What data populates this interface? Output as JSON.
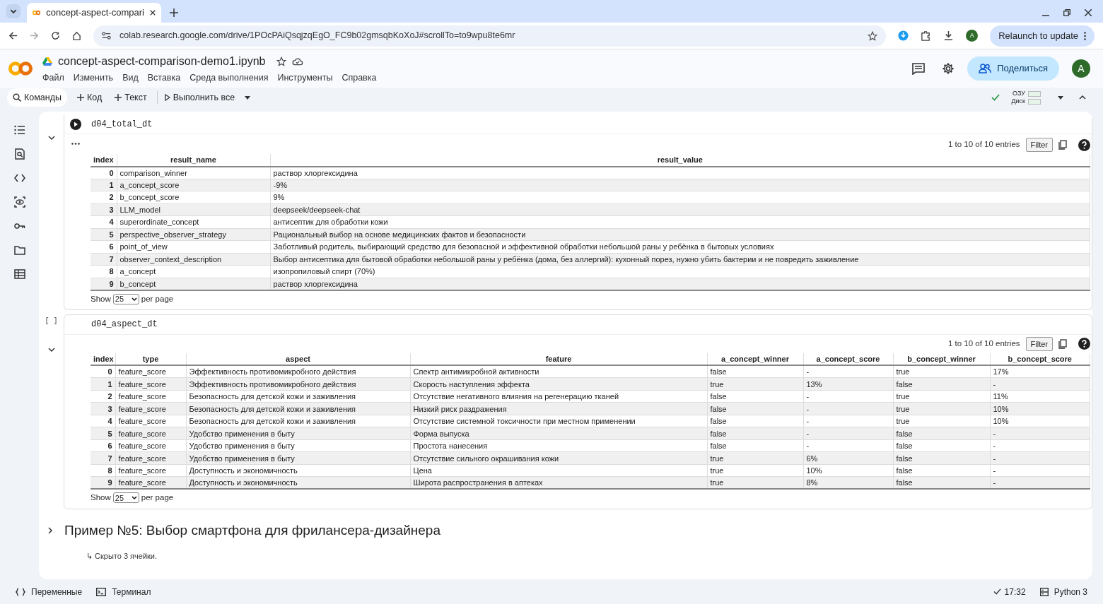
{
  "browser": {
    "tab_title": "concept-aspect-compari",
    "url": "colab.research.google.com/drive/1POcPAiQsqjzqEgO_FC9b02gmsqbKoXoJ#scrollTo=to9wpu8te6mr",
    "profile_letter": "A",
    "relaunch_button": "Relaunch to update"
  },
  "header": {
    "title": "concept-aspect-comparison-demo1.ipynb",
    "menu": [
      "Файл",
      "Изменить",
      "Вид",
      "Вставка",
      "Среда выполнения",
      "Инструменты",
      "Справка"
    ],
    "share_button": "Поделиться",
    "avatar_letter": "A"
  },
  "toolbar": {
    "commands": "Команды",
    "add_code": "Код",
    "add_text": "Текст",
    "run_all": "Выполнить все",
    "ram_label": "ОЗУ",
    "disk_label": "Диск"
  },
  "cells": [
    {
      "code": "d04_total_dt",
      "output": {
        "entries_info": "1 to 10 of 10 entries",
        "filter_button": "Filter",
        "show_label": "Show",
        "page_size": "25",
        "per_page_label": "per page",
        "columns": [
          "index",
          "result_name",
          "result_value"
        ],
        "rows": [
          [
            "0",
            "comparison_winner",
            "раствор хлоргексидина"
          ],
          [
            "1",
            "a_concept_score",
            "-9%"
          ],
          [
            "2",
            "b_concept_score",
            "9%"
          ],
          [
            "3",
            "LLM_model",
            "deepseek/deepseek-chat"
          ],
          [
            "4",
            "superordinate_concept",
            "антисептик для обработки кожи"
          ],
          [
            "5",
            "perspective_observer_strategy",
            "Рациональный выбор на основе медицинских фактов и безопасности"
          ],
          [
            "6",
            "point_of_view",
            "Заботливый родитель, выбирающий средство для безопасной и эффективной обработки небольшой раны у ребёнка в бытовых условиях"
          ],
          [
            "7",
            "observer_context_description",
            "Выбор антисептика для бытовой обработки небольшой раны у ребёнка (дома, без аллергий): кухонный порез, нужно убить бактерии и не повредить заживление"
          ],
          [
            "8",
            "a_concept",
            "изопропиловый спирт (70%)"
          ],
          [
            "9",
            "b_concept",
            "раствор хлоргексидина"
          ]
        ]
      }
    },
    {
      "prompt": "[ ]",
      "code": "d04_aspect_dt",
      "output": {
        "entries_info": "1 to 10 of 10 entries",
        "filter_button": "Filter",
        "show_label": "Show",
        "page_size": "25",
        "per_page_label": "per page",
        "columns": [
          "index",
          "type",
          "aspect",
          "feature",
          "a_concept_winner",
          "a_concept_score",
          "b_concept_winner",
          "b_concept_score"
        ],
        "rows": [
          [
            "0",
            "feature_score",
            "Эффективность противомикробного действия",
            "Спектр антимикробной активности",
            "false",
            "-",
            "true",
            "17%"
          ],
          [
            "1",
            "feature_score",
            "Эффективность противомикробного действия",
            "Скорость наступления эффекта",
            "true",
            "13%",
            "false",
            "-"
          ],
          [
            "2",
            "feature_score",
            "Безопасность для детской кожи и заживления",
            "Отсутствие негативного влияния на регенерацию тканей",
            "false",
            "-",
            "true",
            "11%"
          ],
          [
            "3",
            "feature_score",
            "Безопасность для детской кожи и заживления",
            "Низкий риск раздражения",
            "false",
            "-",
            "true",
            "10%"
          ],
          [
            "4",
            "feature_score",
            "Безопасность для детской кожи и заживления",
            "Отсутствие системной токсичности при местном применении",
            "false",
            "-",
            "true",
            "10%"
          ],
          [
            "5",
            "feature_score",
            "Удобство применения в быту",
            "Форма выпуска",
            "false",
            "-",
            "false",
            "-"
          ],
          [
            "6",
            "feature_score",
            "Удобство применения в быту",
            "Простота нанесения",
            "false",
            "-",
            "false",
            "-"
          ],
          [
            "7",
            "feature_score",
            "Удобство применения в быту",
            "Отсутствие сильного окрашивания кожи",
            "true",
            "6%",
            "false",
            "-"
          ],
          [
            "8",
            "feature_score",
            "Доступность и экономичность",
            "Цена",
            "true",
            "10%",
            "false",
            "-"
          ],
          [
            "9",
            "feature_score",
            "Доступность и экономичность",
            "Широта распространения в аптеках",
            "true",
            "8%",
            "false",
            "-"
          ]
        ]
      }
    }
  ],
  "section": {
    "heading": "Пример №5: Выбор смартфона для фрилансера-дизайнера",
    "expanded": false,
    "hidden_note": "↳ Скрыто 3 ячейки."
  },
  "status_bar": {
    "variables": "Переменные",
    "terminal": "Терминал",
    "time": "17:32",
    "runtime": "Python 3"
  }
}
